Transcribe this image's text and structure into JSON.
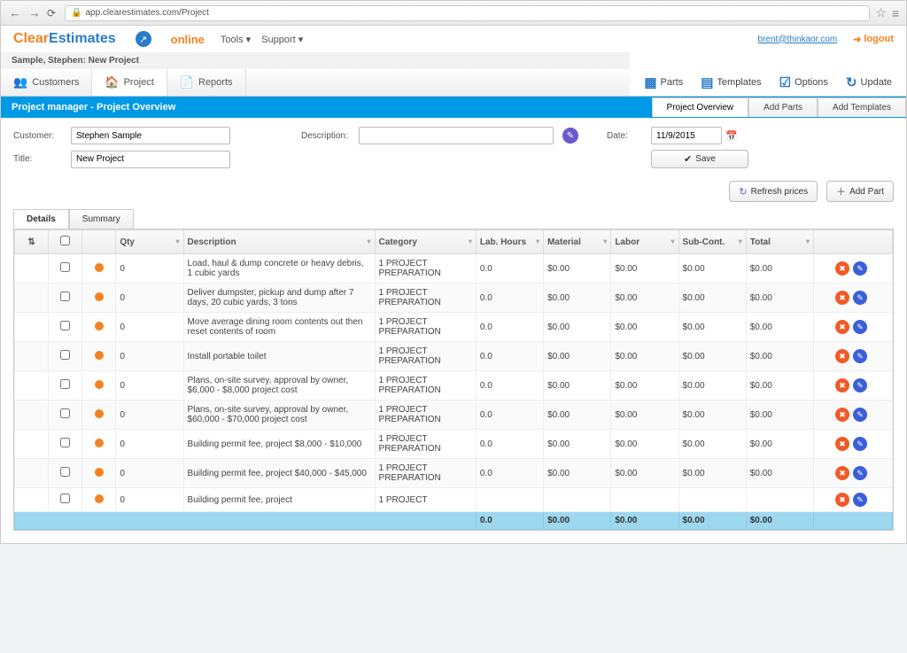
{
  "browser": {
    "url": "app.clearestimates.com/Project"
  },
  "header": {
    "logo_clear": "Clear",
    "logo_estimates": "Estimates",
    "logo_badge": "↗",
    "online": "online",
    "menu_tools": "Tools ▾",
    "menu_support": "Support ▾",
    "user_email": "brent@thinkaor.com",
    "logout": "logout"
  },
  "crumb": {
    "title": "Sample, Stephen: New Project",
    "tab_customers": "Customers",
    "tab_project": "Project",
    "tab_reports": "Reports"
  },
  "actions": {
    "parts": "Parts",
    "templates": "Templates",
    "options": "Options",
    "update": "Update"
  },
  "bluebar": {
    "title": "Project manager - Project Overview",
    "tab_overview": "Project Overview",
    "tab_addparts": "Add Parts",
    "tab_addtemplates": "Add Templates"
  },
  "form": {
    "lbl_customer": "Customer:",
    "customer": "Stephen Sample",
    "lbl_title": "Title:",
    "title": "New Project",
    "lbl_description": "Description:",
    "description": "",
    "lbl_date": "Date:",
    "date": "11/9/2015",
    "save": "Save",
    "refresh": "Refresh prices",
    "addpart": "Add Part"
  },
  "subtabs": {
    "details": "Details",
    "summary": "Summary"
  },
  "grid": {
    "headers": {
      "qty": "Qty",
      "description": "Description",
      "category": "Category",
      "lab": "Lab. Hours",
      "material": "Material",
      "labor": "Labor",
      "subcont": "Sub-Cont.",
      "total": "Total"
    },
    "rows": [
      {
        "qty": "0",
        "desc": "Load, haul & dump concrete or heavy debris, 1 cubic yards",
        "cat": "1 PROJECT PREPARATION",
        "lab": "0.0",
        "mat": "$0.00",
        "labor": "$0.00",
        "sub": "$0.00",
        "total": "$0.00"
      },
      {
        "qty": "0",
        "desc": "Deliver dumpster, pickup and dump after 7 days, 20 cubic yards, 3 tons",
        "cat": "1 PROJECT PREPARATION",
        "lab": "0.0",
        "mat": "$0.00",
        "labor": "$0.00",
        "sub": "$0.00",
        "total": "$0.00"
      },
      {
        "qty": "0",
        "desc": "Move average dining room contents out then reset contents of room",
        "cat": "1 PROJECT PREPARATION",
        "lab": "0.0",
        "mat": "$0.00",
        "labor": "$0.00",
        "sub": "$0.00",
        "total": "$0.00"
      },
      {
        "qty": "0",
        "desc": "Install portable toilet",
        "cat": "1 PROJECT PREPARATION",
        "lab": "0.0",
        "mat": "$0.00",
        "labor": "$0.00",
        "sub": "$0.00",
        "total": "$0.00"
      },
      {
        "qty": "0",
        "desc": "Plans, on-site survey, approval by owner, $6,000 - $8,000 project cost",
        "cat": "1 PROJECT PREPARATION",
        "lab": "0.0",
        "mat": "$0.00",
        "labor": "$0.00",
        "sub": "$0.00",
        "total": "$0.00"
      },
      {
        "qty": "0",
        "desc": "Plans, on-site survey, approval by owner, $60,000 - $70,000 project cost",
        "cat": "1 PROJECT PREPARATION",
        "lab": "0.0",
        "mat": "$0.00",
        "labor": "$0.00",
        "sub": "$0.00",
        "total": "$0.00"
      },
      {
        "qty": "0",
        "desc": "Building permit fee, project $8,000 - $10,000",
        "cat": "1 PROJECT PREPARATION",
        "lab": "0.0",
        "mat": "$0.00",
        "labor": "$0.00",
        "sub": "$0.00",
        "total": "$0.00"
      },
      {
        "qty": "0",
        "desc": "Building permit fee, project $40,000 - $45,000",
        "cat": "1 PROJECT PREPARATION",
        "lab": "0.0",
        "mat": "$0.00",
        "labor": "$0.00",
        "sub": "$0.00",
        "total": "$0.00"
      },
      {
        "qty": "0",
        "desc": "Building permit fee, project",
        "cat": "1 PROJECT",
        "lab": "",
        "mat": "",
        "labor": "",
        "sub": "",
        "total": ""
      }
    ],
    "footer": {
      "lab": "0.0",
      "mat": "$0.00",
      "labor": "$0.00",
      "sub": "$0.00",
      "total": "$0.00"
    }
  }
}
